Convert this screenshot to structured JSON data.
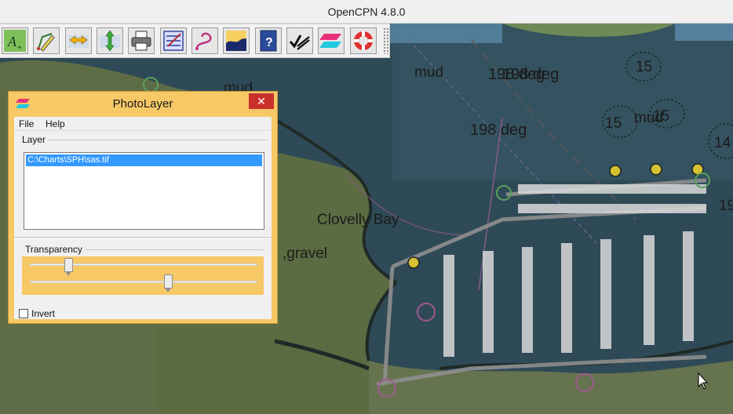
{
  "window": {
    "title": "OpenCPN 4.8.0"
  },
  "toolbar": {
    "buttons": [
      {
        "icon": "ais-target-icon"
      },
      {
        "icon": "route-pencil-icon"
      },
      {
        "icon": "zoom-out-horizontal-icon"
      },
      {
        "icon": "zoom-in-vertical-icon"
      },
      {
        "icon": "print-icon"
      },
      {
        "icon": "settings-checklist-icon"
      },
      {
        "icon": "track-icon"
      },
      {
        "icon": "tide-current-icon"
      },
      {
        "icon": "help-icon"
      },
      {
        "icon": "chart-quilting-icon"
      },
      {
        "icon": "photolayer-icon"
      },
      {
        "icon": "mob-lifebuoy-icon"
      }
    ]
  },
  "chart": {
    "labels": {
      "mud_1": "mud",
      "mud_2": "mud",
      "mud_3": "mud",
      "bearing_1": "198 deg",
      "bearing_2": "198 deg",
      "bearing_3": "198 deg",
      "depth_15_a": "15",
      "depth_15_b": "15",
      "depth_15_c": "15",
      "depth_14": "14",
      "depth_19": "19",
      "bay": "Clovelly Bay",
      "seabed": ",gravel"
    }
  },
  "dialog": {
    "title": "PhotoLayer",
    "close_label": "✕",
    "menu": {
      "file": "File",
      "help": "Help"
    },
    "layer_group_label": "Layer",
    "layer_items": [
      "C:\\Charts\\SPH\\sas.tif"
    ],
    "transparency_group_label": "Transparency",
    "slider_1_value": 0.17,
    "slider_2_value": 0.61,
    "invert_label": "Invert",
    "invert_checked": false
  },
  "colors": {
    "dialog_bg": "#f7c866",
    "selection": "#3399ff",
    "close": "#c9302c",
    "water": "#2f4a57",
    "land": "#5c6a40"
  }
}
